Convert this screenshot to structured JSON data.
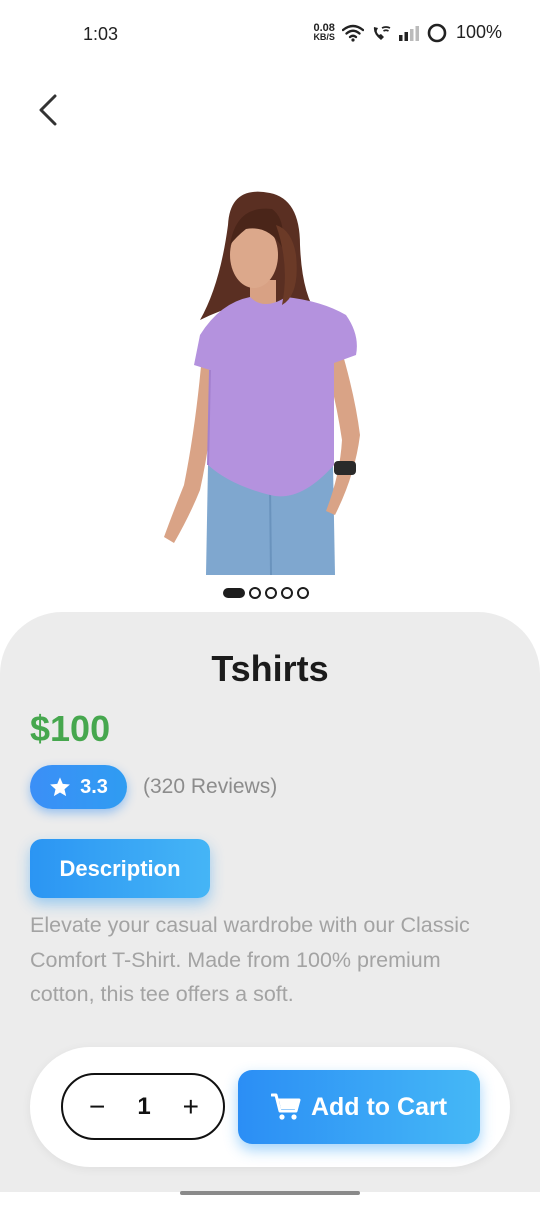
{
  "status_bar": {
    "time": "1:03",
    "net_speed_value": "0.08",
    "net_speed_unit": "KB/S",
    "battery": "100%"
  },
  "icons": {
    "back": "chevron-left-icon",
    "wifi": "wifi-icon",
    "call": "wifi-call-icon",
    "signal": "signal-icon",
    "battery": "battery-ring-icon",
    "star": "star-icon",
    "cart": "shopping-cart-icon"
  },
  "gallery": {
    "image_alt": "Woman in lavender t-shirt",
    "total_images": 5,
    "active_index": 0
  },
  "product": {
    "title": "Tshirts",
    "price": "$100",
    "rating": "3.3",
    "reviews": "(320 Reviews)",
    "description_label": "Description",
    "description": "Elevate your casual wardrobe with our Classic Comfort T-Shirt. Made from 100% premium cotton, this tee offers a soft."
  },
  "cart": {
    "decrement": "−",
    "quantity": "1",
    "increment": "+",
    "add_label": "Add to Cart"
  },
  "colors": {
    "price_green": "#46a74e",
    "accent_blue": "#2b8ef5",
    "sheet_bg": "#ececec",
    "tshirt_lavender": "#b492de"
  }
}
